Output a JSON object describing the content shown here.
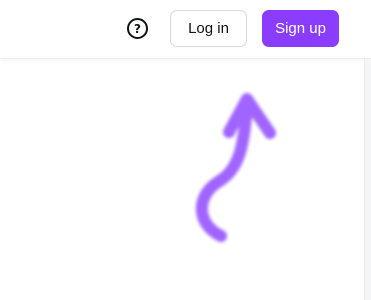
{
  "header": {
    "help_icon": "question-circle-icon",
    "help_glyph": "?",
    "login_label": "Log in",
    "signup_label": "Sign up"
  },
  "decoration": {
    "arrow_icon": "hand-drawn-arrow-icon",
    "arrow_color": "#9b5cff"
  },
  "colors": {
    "brand": "#8b3dff",
    "text": "#0e1318",
    "button_border": "#d6d9df"
  }
}
